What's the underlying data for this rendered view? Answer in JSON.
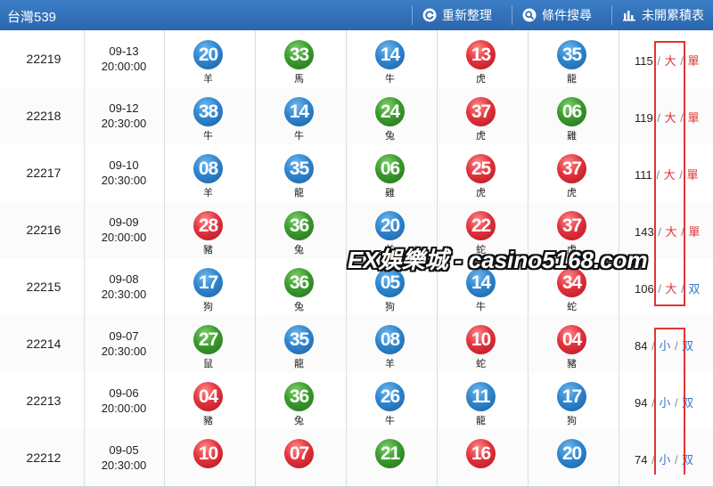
{
  "header": {
    "title": "台灣539",
    "buttons": [
      {
        "label": "重新整理",
        "icon": "refresh-icon"
      },
      {
        "label": "條件搜尋",
        "icon": "search-icon"
      },
      {
        "label": "未開累積表",
        "icon": "bar-chart-icon"
      }
    ]
  },
  "colors": {
    "blue": "#2f86cf",
    "green": "#3b9a2e",
    "red": "#e2333d",
    "header": "#2f6fb7",
    "highlight": "#e23434"
  },
  "rows": [
    {
      "issue": "22219",
      "date": "09-13",
      "time": "20:00:00",
      "balls": [
        {
          "n": "20",
          "c": "blue",
          "z": "羊"
        },
        {
          "n": "33",
          "c": "green",
          "z": "馬"
        },
        {
          "n": "14",
          "c": "blue",
          "z": "牛"
        },
        {
          "n": "13",
          "c": "red",
          "z": "虎"
        },
        {
          "n": "35",
          "c": "blue",
          "z": "龍"
        }
      ],
      "sum": "115",
      "size": "大",
      "parity": "單"
    },
    {
      "issue": "22218",
      "date": "09-12",
      "time": "20:30:00",
      "balls": [
        {
          "n": "38",
          "c": "blue",
          "z": "牛"
        },
        {
          "n": "14",
          "c": "blue",
          "z": "牛"
        },
        {
          "n": "24",
          "c": "green",
          "z": "兔"
        },
        {
          "n": "37",
          "c": "red",
          "z": "虎"
        },
        {
          "n": "06",
          "c": "green",
          "z": "雞"
        }
      ],
      "sum": "119",
      "size": "大",
      "parity": "單"
    },
    {
      "issue": "22217",
      "date": "09-10",
      "time": "20:30:00",
      "balls": [
        {
          "n": "08",
          "c": "blue",
          "z": "羊"
        },
        {
          "n": "35",
          "c": "blue",
          "z": "龍"
        },
        {
          "n": "06",
          "c": "green",
          "z": "雞"
        },
        {
          "n": "25",
          "c": "red",
          "z": "虎"
        },
        {
          "n": "37",
          "c": "red",
          "z": "虎"
        }
      ],
      "sum": "111",
      "size": "大",
      "parity": "單"
    },
    {
      "issue": "22216",
      "date": "09-09",
      "time": "20:00:00",
      "balls": [
        {
          "n": "28",
          "c": "red",
          "z": "豬"
        },
        {
          "n": "36",
          "c": "green",
          "z": "兔"
        },
        {
          "n": "20",
          "c": "blue",
          "z": "羊"
        },
        {
          "n": "22",
          "c": "red",
          "z": "蛇"
        },
        {
          "n": "37",
          "c": "red",
          "z": "虎"
        }
      ],
      "sum": "143",
      "size": "大",
      "parity": "單"
    },
    {
      "issue": "22215",
      "date": "09-08",
      "time": "20:30:00",
      "balls": [
        {
          "n": "17",
          "c": "blue",
          "z": "狗"
        },
        {
          "n": "36",
          "c": "green",
          "z": "兔"
        },
        {
          "n": "05",
          "c": "blue",
          "z": "狗"
        },
        {
          "n": "14",
          "c": "blue",
          "z": "牛"
        },
        {
          "n": "34",
          "c": "red",
          "z": "蛇"
        }
      ],
      "sum": "106",
      "size": "大",
      "parity": "双"
    },
    {
      "issue": "22214",
      "date": "09-07",
      "time": "20:30:00",
      "balls": [
        {
          "n": "27",
          "c": "green",
          "z": "鼠"
        },
        {
          "n": "35",
          "c": "blue",
          "z": "龍"
        },
        {
          "n": "08",
          "c": "blue",
          "z": "羊"
        },
        {
          "n": "10",
          "c": "red",
          "z": "蛇"
        },
        {
          "n": "04",
          "c": "red",
          "z": "豬"
        }
      ],
      "sum": "84",
      "size": "小",
      "parity": "双"
    },
    {
      "issue": "22213",
      "date": "09-06",
      "time": "20:00:00",
      "balls": [
        {
          "n": "04",
          "c": "red",
          "z": "豬"
        },
        {
          "n": "36",
          "c": "green",
          "z": "兔"
        },
        {
          "n": "26",
          "c": "blue",
          "z": "牛"
        },
        {
          "n": "11",
          "c": "blue",
          "z": "龍"
        },
        {
          "n": "17",
          "c": "blue",
          "z": "狗"
        }
      ],
      "sum": "94",
      "size": "小",
      "parity": "双"
    },
    {
      "issue": "22212",
      "date": "09-05",
      "time": "20:30:00",
      "balls": [
        {
          "n": "10",
          "c": "red",
          "z": ""
        },
        {
          "n": "07",
          "c": "red",
          "z": ""
        },
        {
          "n": "21",
          "c": "green",
          "z": ""
        },
        {
          "n": "16",
          "c": "red",
          "z": ""
        },
        {
          "n": "20",
          "c": "blue",
          "z": ""
        }
      ],
      "sum": "74",
      "size": "小",
      "parity": "双"
    }
  ],
  "watermark": "EX娛樂城 - casino5168.com"
}
